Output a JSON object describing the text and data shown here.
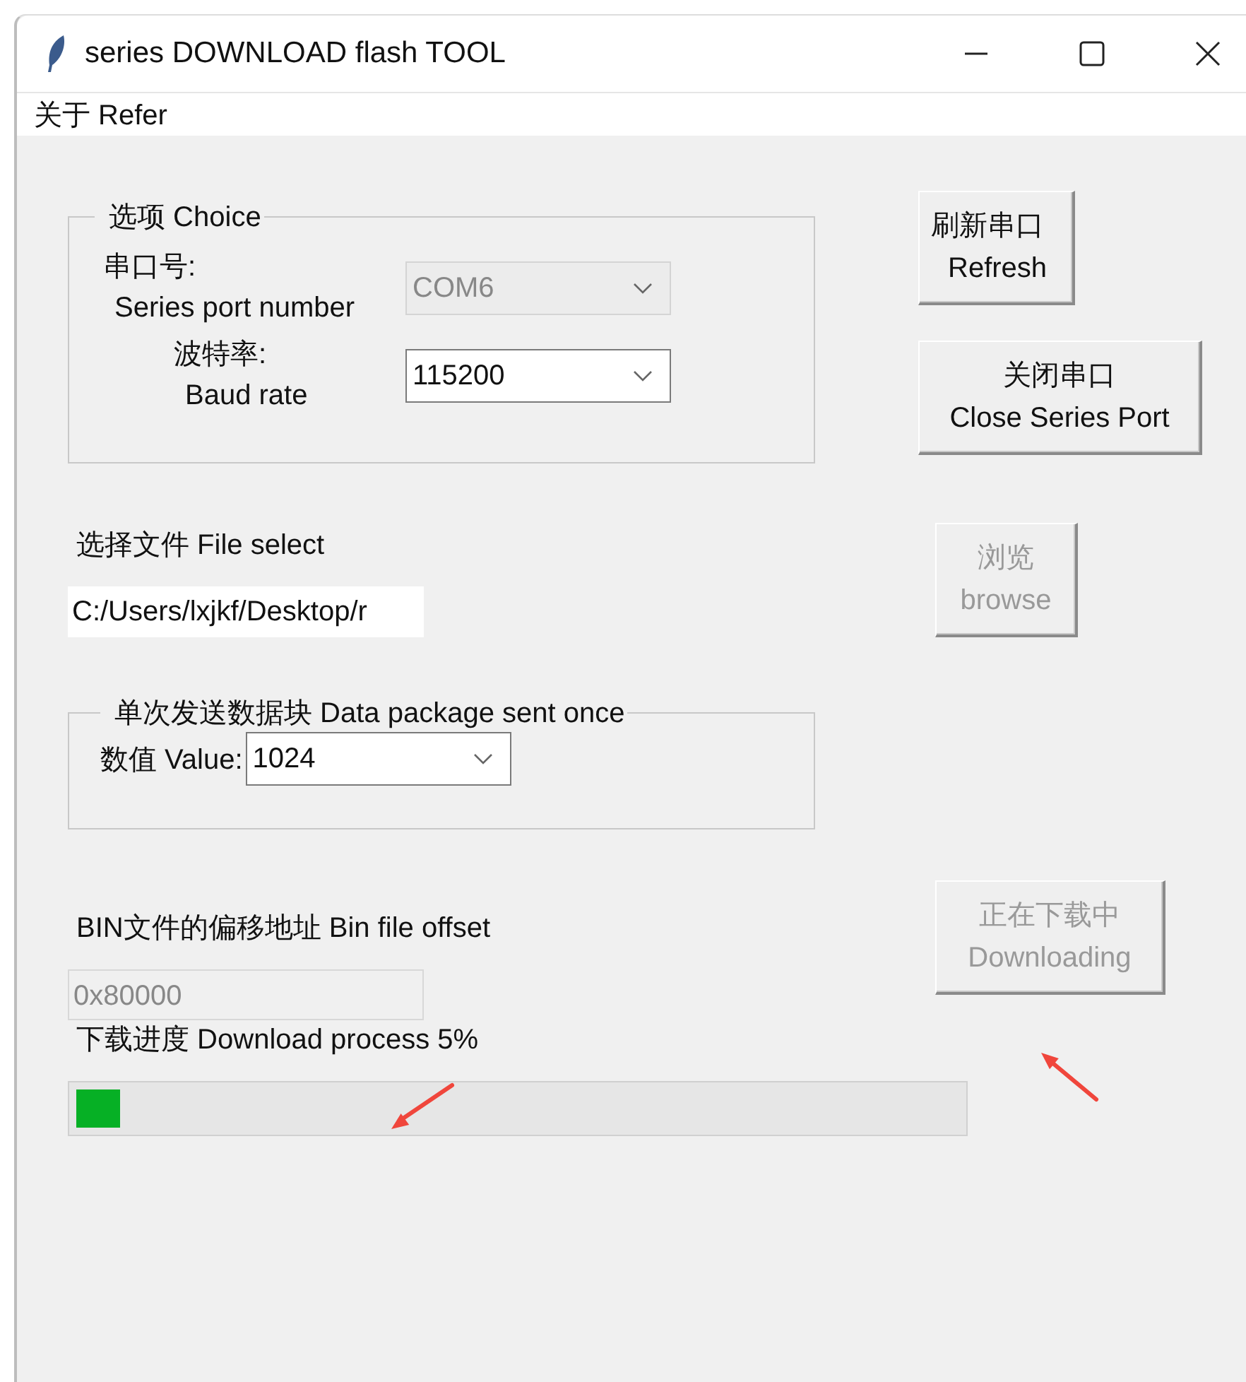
{
  "window": {
    "title": "series DOWNLOAD flash TOOL"
  },
  "menu": [
    "关于 Refer"
  ],
  "choice_group": {
    "legend": "选项 Choice",
    "fields": [
      {
        "label_lines": [
          "串口号:",
          "Series port number"
        ],
        "value": "COM6",
        "disabled": true
      },
      {
        "label_lines": [
          "波特率:",
          "Baud rate"
        ],
        "value": "115200",
        "disabled": false
      }
    ]
  },
  "port_buttons": [
    {
      "lines": [
        "刷新串口",
        "Refresh"
      ],
      "disabled": false
    },
    {
      "lines": [
        "关闭串口",
        "Close Series Port"
      ],
      "disabled": false
    }
  ],
  "file_select": {
    "label": "选择文件 File select",
    "value": "C:/Users/lxjkf/Desktop/r",
    "button": {
      "lines": [
        "浏览",
        "browse"
      ],
      "disabled": true
    }
  },
  "package_group": {
    "legend": "单次发送数据块 Data package sent once",
    "label": "数值 Value:",
    "value": "1024",
    "disabled": false
  },
  "offset": {
    "label": "BIN文件的偏移地址 Bin file offset",
    "value": "0x80000",
    "disabled": true,
    "button": {
      "lines": [
        "正在下载中",
        "Downloading"
      ],
      "disabled": true
    }
  },
  "progress": {
    "label": "下载进度 Download process 5%",
    "level": 0.05
  }
}
